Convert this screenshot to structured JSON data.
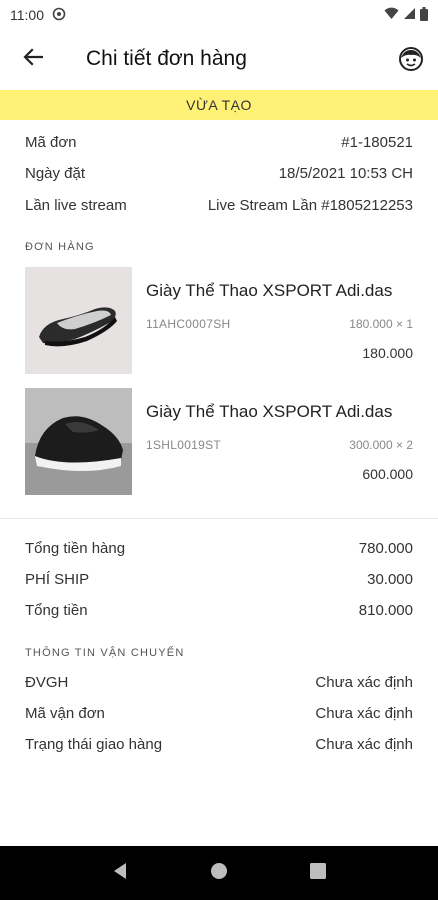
{
  "status_bar": {
    "time": "11:00"
  },
  "header": {
    "title": "Chi tiết đơn hàng"
  },
  "order_status": "VỪA TẠO",
  "order_info": [
    {
      "label": "Mã đơn",
      "value": "#1-180521"
    },
    {
      "label": "Ngày đặt",
      "value": "18/5/2021 10:53 CH"
    },
    {
      "label": "Lần live stream",
      "value": "Live Stream Lần #1805212253"
    }
  ],
  "items_section_title": "ĐƠN HÀNG",
  "items": [
    {
      "name": "Giày Thể Thao XSPORT Adi.das",
      "sku": "11AHC0007SH",
      "qty_price": "180.000 × 1",
      "total": "180.000"
    },
    {
      "name": "Giày Thể Thao XSPORT Adi.das",
      "sku": "1SHL0019ST",
      "qty_price": "300.000 × 2",
      "total": "600.000"
    }
  ],
  "totals": [
    {
      "label": "Tổng tiền hàng",
      "value": "780.000"
    },
    {
      "label": "PHÍ SHIP",
      "value": "30.000"
    },
    {
      "label": "Tổng tiền",
      "value": "810.000"
    }
  ],
  "shipping_section_title": "THÔNG TIN VẬN CHUYỂN",
  "shipping": [
    {
      "label": "ĐVGH",
      "value": "Chưa xác định"
    },
    {
      "label": "Mã vận đơn",
      "value": "Chưa xác định"
    },
    {
      "label": "Trạng thái giao hàng",
      "value": "Chưa xác định"
    }
  ],
  "colors": {
    "status_strip": "#fff176",
    "nav_bar": "#000000"
  },
  "icons": [
    "back-arrow-icon",
    "avatar-icon",
    "wifi-icon",
    "signal-icon",
    "battery-icon",
    "nav-back-icon",
    "nav-home-icon",
    "nav-recents-icon"
  ]
}
